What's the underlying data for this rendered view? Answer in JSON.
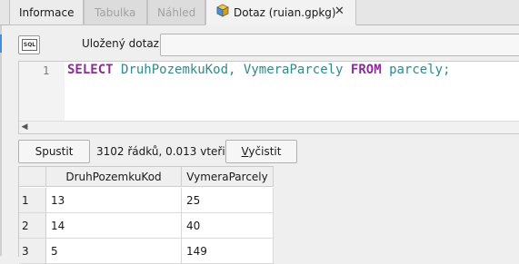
{
  "tabs": [
    {
      "label": "Informace",
      "state": "normal"
    },
    {
      "label": "Tabulka",
      "state": "disabled"
    },
    {
      "label": "Náhled",
      "state": "disabled"
    },
    {
      "label": "Dotaz (ruian.gpkg)",
      "state": "active",
      "icon": "database-cube-icon",
      "close": "✕"
    }
  ],
  "query": {
    "sql_icon_text": "SQL",
    "saved_label": "Uložený dotaz",
    "saved_value": ""
  },
  "editor": {
    "line_number": "1",
    "tokens": {
      "select": "SELECT",
      "col1": "DruhPozemkuKod",
      "comma": ",",
      "col2": "VymeraParcely",
      "from": "FROM",
      "table": "parcely",
      "semicolon": ";"
    },
    "scroll_left_glyph": "◀"
  },
  "actions": {
    "run_label": "Spustit",
    "status": "3102 řádků, 0.013 vteřin",
    "clear_label_first": "V",
    "clear_label_rest": "yčistit"
  },
  "results": {
    "columns": [
      "DruhPozemkuKod",
      "VymeraParcely"
    ],
    "rows": [
      {
        "n": "1",
        "c1": "13",
        "c2": "25"
      },
      {
        "n": "2",
        "c1": "14",
        "c2": "40"
      },
      {
        "n": "3",
        "c1": "5",
        "c2": "149"
      }
    ]
  },
  "colors": {
    "keyword": "#8b2c98",
    "identifier": "#2e8a8f",
    "accent": "#3d8ee6"
  }
}
